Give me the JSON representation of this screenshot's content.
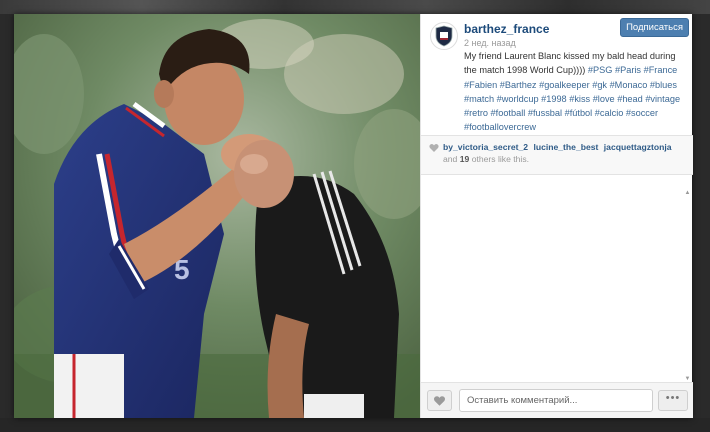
{
  "post": {
    "username": "barthez_france",
    "time": "2 нед. назад",
    "follow_label": "Подписаться",
    "caption_text": "My friend Laurent Blanc kissed my bald head during the match 1998 World Cup))))",
    "hashtags": "#PSG #Paris #France #Fabien #Barthez #goalkeeper #gk #Monaco #blues #match #worldcup #1998 #kiss #love #head #vintage #retro #football #fussbal #fútbol #calcio #soccer #footballovercrew"
  },
  "likes": {
    "users": [
      "by_victoria_secret_2",
      "lucine_the_best",
      "jacquettagztonja"
    ],
    "others_prefix": "and",
    "others_count": "19",
    "others_suffix": "others like this."
  },
  "footer": {
    "comment_placeholder": "Оставить комментарий...",
    "more_label": "•••"
  },
  "icons": {
    "avatar": "club-crest-icon",
    "like": "heart-icon",
    "likes_heart": "heart-icon"
  },
  "colors": {
    "username": "#1c4a7a",
    "follow_button": "#4d7fb0",
    "hashtag": "#3d6a96"
  }
}
